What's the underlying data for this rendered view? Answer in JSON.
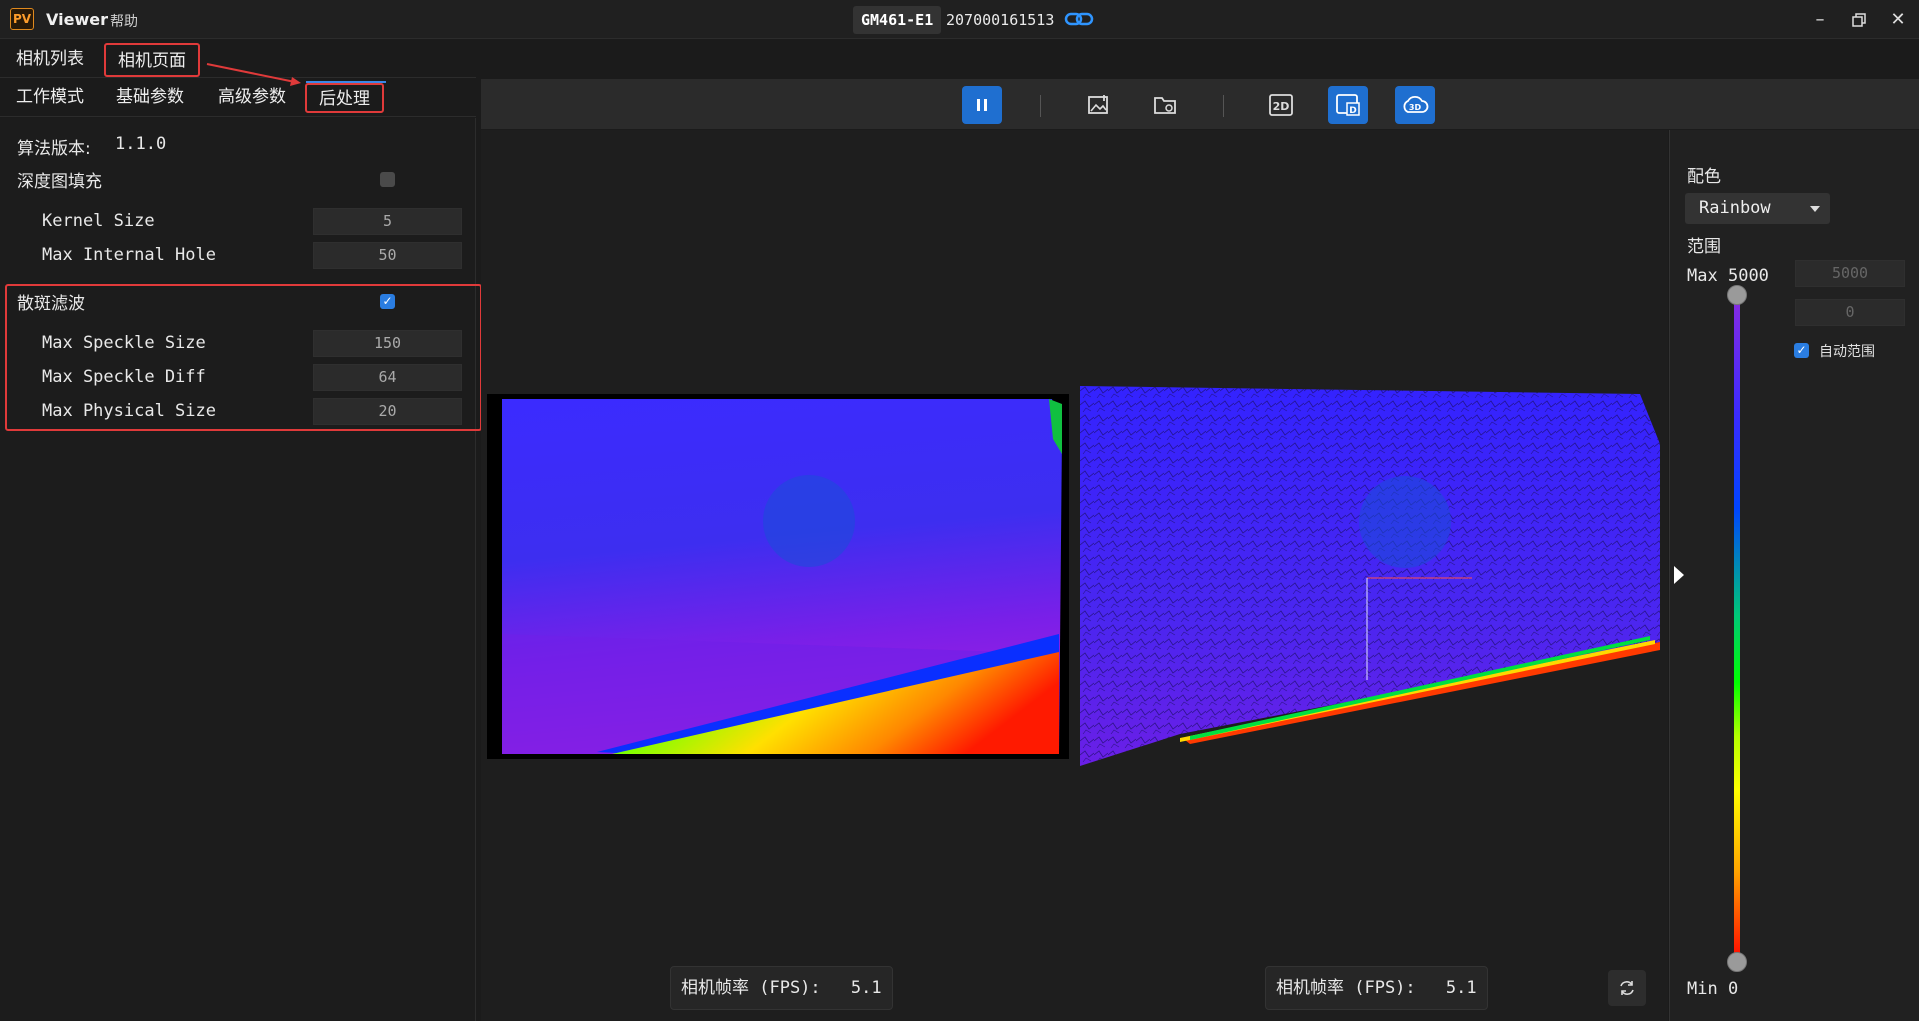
{
  "titlebar": {
    "logo": "PV",
    "app_name": "Viewer",
    "help": "帮助",
    "model": "GM461-E1",
    "serial": "207000161513",
    "link_icon": "link-icon",
    "controls": [
      "minimize-icon",
      "restore-icon",
      "close-icon"
    ]
  },
  "main_tabs": [
    "相机列表",
    "相机页面"
  ],
  "sub_tabs": [
    "工作模式",
    "基础参数",
    "高级参数",
    "后处理"
  ],
  "postprocess": {
    "algo_version_label": "算法版本:",
    "algo_version_value": "1.1.0",
    "depth_fill_label": "深度图填充",
    "depth_fill_checked": false,
    "kernel_size_label": "Kernel Size",
    "kernel_size_value": "5",
    "max_internal_hole_label": "Max Internal Hole",
    "max_internal_hole_value": "50",
    "speckle_label": "散斑滤波",
    "speckle_checked": true,
    "max_speckle_size_label": "Max Speckle Size",
    "max_speckle_size_value": "150",
    "max_speckle_diff_label": "Max Speckle Diff",
    "max_speckle_diff_value": "64",
    "max_physical_size_label": "Max Physical Size",
    "max_physical_size_value": "20"
  },
  "toolbar": {
    "buttons": [
      "pause-icon",
      "save-image-icon",
      "open-folder-icon",
      "2d-icon",
      "depth-icon",
      "3d-cloud-icon"
    ]
  },
  "viewer": {
    "fps_left_label": "相机帧率 (FPS):",
    "fps_left_value": "5.1",
    "fps_right_label": "相机帧率 (FPS):",
    "fps_right_value": "5.1"
  },
  "right_panel": {
    "palette_label": "配色",
    "palette_value": "Rainbow",
    "range_label": "范围",
    "max_label": "Max",
    "max_value": "5000",
    "max_field": "5000",
    "min_field": "0",
    "auto_range_label": "自动范围",
    "auto_range_checked": true,
    "min_label": "Min",
    "min_value": "0"
  },
  "colors": {
    "accent": "#1f6fd0",
    "highlight": "#e03a3a",
    "panel": "#1c1c1c"
  }
}
